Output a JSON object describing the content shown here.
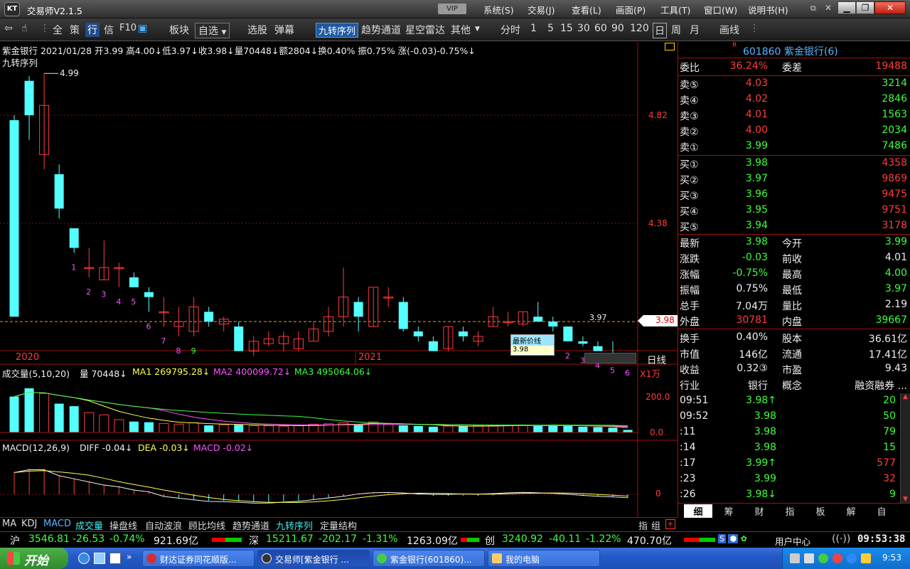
{
  "app": {
    "logo": "KT",
    "title": "交易师V2.1.5",
    "vip": "VIP"
  },
  "menu": [
    "系统(S)",
    "交易(J)",
    "查看(L)",
    "画面(P)",
    "工具(T)",
    "窗口(W)",
    "说明书(H)"
  ],
  "toolbar": {
    "all": "全",
    "policy": "策",
    "quote": "行",
    "info": "信",
    "f10": "F10",
    "sector": "板块",
    "watch": "自选",
    "select": "选股",
    "popup": "弹幕",
    "nine": "九转序列",
    "trend": "趋势通道",
    "radar": "星空雷达",
    "other": "其他",
    "periods": [
      "分时",
      "1",
      "5",
      "15",
      "30",
      "60",
      "90",
      "120",
      "日",
      "周",
      "月"
    ],
    "draw": "画线"
  },
  "kline": {
    "info": "紫金银行 2021/01/28 开3.99 高4.00↓低3.97↓收3.98↓量70448↓额2804↓换0.40% 振0.75% 涨(-0.03)-0.75%↓",
    "indicator": "九转序列",
    "peak": "4.99",
    "ticks": [
      "4.82",
      "4.38"
    ],
    "current_price": "3.98",
    "low_label": "3.97",
    "tooltip_title": "最新价线",
    "tooltip_value": "3.98",
    "years": [
      "2020",
      "2021"
    ],
    "period": "日线"
  },
  "volume": {
    "title": "成交量(5,10,20)",
    "v": "量 70448↓",
    "ma1": "MA1 269795.28↓",
    "ma2": "MA2 400099.72↓",
    "ma3": "MA3 495064.06↓",
    "unit": "X1万",
    "ticks": [
      "200.0",
      "0.0"
    ]
  },
  "macd": {
    "title": "MACD(12,26,9)",
    "diff": "DIFF -0.04↓",
    "dea": "DEA -0.03↓",
    "macd": "MACD -0.02↓",
    "tick": "0"
  },
  "bottom_tabs": [
    "MA",
    "KDJ",
    "MACD",
    "成交量",
    "操盘线",
    "自动波浪",
    "顾比均线",
    "趋势通道",
    "九转序列",
    "定量结构"
  ],
  "bottom_right": [
    "指",
    "组"
  ],
  "header": {
    "flag": "R",
    "code_name": "601860 紫金银行(6)"
  },
  "weibi": {
    "label": "委比",
    "value": "36.24%",
    "diff_label": "委差",
    "diff": "19488"
  },
  "sell": [
    {
      "l": "卖⑤",
      "p": "4.03",
      "v": "3214"
    },
    {
      "l": "卖④",
      "p": "4.02",
      "v": "2846"
    },
    {
      "l": "卖③",
      "p": "4.01",
      "v": "1563"
    },
    {
      "l": "卖②",
      "p": "4.00",
      "v": "2034"
    },
    {
      "l": "卖①",
      "p": "3.99",
      "v": "7486"
    }
  ],
  "buy": [
    {
      "l": "买①",
      "p": "3.98",
      "v": "4358"
    },
    {
      "l": "买②",
      "p": "3.97",
      "v": "9869"
    },
    {
      "l": "买③",
      "p": "3.96",
      "v": "9475"
    },
    {
      "l": "买④",
      "p": "3.95",
      "v": "9751"
    },
    {
      "l": "买⑤",
      "p": "3.94",
      "v": "3178"
    }
  ],
  "stats": [
    {
      "l1": "最新",
      "v1": "3.98",
      "c1": "grn",
      "l2": "今开",
      "v2": "3.99",
      "c2": "grn"
    },
    {
      "l1": "涨跌",
      "v1": "-0.03",
      "c1": "grn",
      "l2": "前收",
      "v2": "4.01",
      "c2": "wht"
    },
    {
      "l1": "涨幅",
      "v1": "-0.75%",
      "c1": "grn",
      "l2": "最高",
      "v2": "4.00",
      "c2": "grn"
    },
    {
      "l1": "振幅",
      "v1": "0.75%",
      "c1": "wht",
      "l2": "最低",
      "v2": "3.97",
      "c2": "grn"
    },
    {
      "l1": "总手",
      "v1": "7.04万",
      "c1": "wht",
      "l2": "量比",
      "v2": "2.19",
      "c2": "wht"
    },
    {
      "l1": "外盘",
      "v1": "30781",
      "c1": "red",
      "l2": "内盘",
      "v2": "39667",
      "c2": "grn"
    },
    {
      "l1": "换手",
      "v1": "0.40%",
      "c1": "wht",
      "l2": "股本",
      "v2": "36.61亿",
      "c2": "wht"
    },
    {
      "l1": "市值",
      "v1": "146亿",
      "c1": "wht",
      "l2": "流通",
      "v2": "17.41亿",
      "c2": "wht"
    },
    {
      "l1": "收益",
      "v1": "0.32③",
      "c1": "wht",
      "l2": "市盈",
      "v2": "9.43",
      "c2": "wht"
    },
    {
      "l1": "行业",
      "v1": "银行",
      "c1": "wht",
      "l2": "概念",
      "v2": "融资融券 ...",
      "c2": "wht"
    }
  ],
  "ticks": [
    {
      "t": "09:51",
      "p": "3.98↑",
      "pc": "grn",
      "v": "20",
      "vc": "grn"
    },
    {
      "t": "09:52",
      "p": "3.98",
      "pc": "grn",
      "v": "50",
      "vc": "grn"
    },
    {
      "t": ":11",
      "p": "3.98",
      "pc": "grn",
      "v": "79",
      "vc": "grn"
    },
    {
      "t": ":14",
      "p": "3.98",
      "pc": "grn",
      "v": "15",
      "vc": "grn"
    },
    {
      "t": ":17",
      "p": "3.99↑",
      "pc": "grn",
      "v": "577",
      "vc": "red"
    },
    {
      "t": ":23",
      "p": "3.99",
      "pc": "grn",
      "v": "32",
      "vc": "red"
    },
    {
      "t": ":26",
      "p": "3.98↓",
      "pc": "grn",
      "v": "9",
      "vc": "grn"
    }
  ],
  "right_tabs": [
    "细",
    "筹",
    "财",
    "指",
    "板",
    "解",
    "自"
  ],
  "index": {
    "sh": "沪",
    "sh_v": "3546.81",
    "sh_c": "-26.53",
    "sh_p": "-0.74%",
    "sh_a": "921.69亿",
    "sz": "深",
    "sz_v": "15211.67",
    "sz_c": "-202.17",
    "sz_p": "-1.31%",
    "sz_a": "1263.09亿",
    "cy": "创",
    "cy_v": "3240.92",
    "cy_c": "-40.11",
    "cy_p": "-1.22%",
    "cy_a": "470.70亿",
    "user": "用户中心",
    "time": "09:53:38"
  },
  "taskbar": {
    "start": "开始",
    "tasks": [
      "财达证券同花顺版...",
      "交易师[紫金银行 ...",
      "紫金银行(601860)...",
      "我的电脑"
    ],
    "clock": "9:53"
  },
  "chart_data": {
    "type": "candlestick",
    "candles": [
      {
        "o": 4.8,
        "h": 4.82,
        "l": 4.0,
        "c": 4.0
      },
      {
        "o": 4.96,
        "h": 4.98,
        "l": 4.72,
        "c": 4.82
      },
      {
        "o": 4.66,
        "h": 4.99,
        "l": 4.6,
        "c": 4.86
      },
      {
        "o": 4.58,
        "h": 4.62,
        "l": 4.4,
        "c": 4.44
      },
      {
        "o": 4.36,
        "h": 4.36,
        "l": 4.26,
        "c": 4.28
      },
      {
        "o": 4.2,
        "h": 4.28,
        "l": 4.16,
        "c": 4.2
      },
      {
        "o": 4.15,
        "h": 4.31,
        "l": 4.15,
        "c": 4.2
      },
      {
        "o": 4.2,
        "h": 4.22,
        "l": 4.12,
        "c": 4.2
      },
      {
        "o": 4.16,
        "h": 4.18,
        "l": 4.12,
        "c": 4.12
      },
      {
        "o": 4.1,
        "h": 4.12,
        "l": 4.02,
        "c": 4.08
      },
      {
        "o": 4.02,
        "h": 4.08,
        "l": 3.96,
        "c": 4.02
      },
      {
        "o": 3.96,
        "h": 4.04,
        "l": 3.92,
        "c": 3.98
      },
      {
        "o": 3.94,
        "h": 4.08,
        "l": 3.92,
        "c": 4.04
      },
      {
        "o": 4.02,
        "h": 4.04,
        "l": 3.96,
        "c": 3.98
      },
      {
        "o": 3.97,
        "h": 4.0,
        "l": 3.94,
        "c": 3.99
      },
      {
        "o": 3.96,
        "h": 3.98,
        "l": 3.86,
        "c": 3.86
      },
      {
        "o": 3.86,
        "h": 3.92,
        "l": 3.84,
        "c": 3.9
      },
      {
        "o": 3.89,
        "h": 3.94,
        "l": 3.88,
        "c": 3.91
      },
      {
        "o": 3.89,
        "h": 3.94,
        "l": 3.86,
        "c": 3.92
      },
      {
        "o": 3.87,
        "h": 3.94,
        "l": 3.86,
        "c": 3.91
      },
      {
        "o": 3.9,
        "h": 3.98,
        "l": 3.9,
        "c": 3.95
      },
      {
        "o": 3.94,
        "h": 4.04,
        "l": 3.92,
        "c": 4.0
      },
      {
        "o": 4.0,
        "h": 4.2,
        "l": 3.96,
        "c": 4.08
      },
      {
        "o": 4.06,
        "h": 4.08,
        "l": 3.94,
        "c": 4.0
      },
      {
        "o": 3.96,
        "h": 4.12,
        "l": 3.96,
        "c": 4.12
      },
      {
        "o": 4.08,
        "h": 4.12,
        "l": 4.04,
        "c": 4.08
      },
      {
        "o": 4.06,
        "h": 4.08,
        "l": 3.94,
        "c": 3.95
      },
      {
        "o": 3.94,
        "h": 3.96,
        "l": 3.9,
        "c": 3.92
      },
      {
        "o": 3.9,
        "h": 3.92,
        "l": 3.86,
        "c": 3.86
      },
      {
        "o": 3.87,
        "h": 3.96,
        "l": 3.86,
        "c": 3.96
      },
      {
        "o": 3.94,
        "h": 3.96,
        "l": 3.9,
        "c": 3.92
      },
      {
        "o": 3.9,
        "h": 3.94,
        "l": 3.88,
        "c": 3.92
      },
      {
        "o": 3.96,
        "h": 4.04,
        "l": 3.96,
        "c": 4.0
      },
      {
        "o": 3.98,
        "h": 4.02,
        "l": 3.96,
        "c": 3.98
      },
      {
        "o": 3.97,
        "h": 4.02,
        "l": 3.96,
        "c": 4.02
      },
      {
        "o": 4.0,
        "h": 4.06,
        "l": 3.98,
        "c": 3.98
      },
      {
        "o": 3.98,
        "h": 4.0,
        "l": 3.94,
        "c": 3.96
      },
      {
        "o": 3.96,
        "h": 3.96,
        "l": 3.9,
        "c": 3.9
      },
      {
        "o": 3.9,
        "h": 3.92,
        "l": 3.88,
        "c": 3.89
      },
      {
        "o": 3.88,
        "h": 3.9,
        "l": 3.86,
        "c": 3.86
      },
      {
        "o": 3.85,
        "h": 3.9,
        "l": 3.84,
        "c": 3.84
      },
      {
        "o": 3.84,
        "h": 3.84,
        "l": 3.83,
        "c": 3.83
      }
    ],
    "nine_seq": [
      {
        "i": 4,
        "n": "1"
      },
      {
        "i": 5,
        "n": "2"
      },
      {
        "i": 6,
        "n": "3"
      },
      {
        "i": 7,
        "n": "4"
      },
      {
        "i": 8,
        "n": "5"
      },
      {
        "i": 9,
        "n": "6"
      },
      {
        "i": 10,
        "n": "7"
      },
      {
        "i": 11,
        "n": "8"
      },
      {
        "i": 12,
        "n": "9"
      },
      {
        "i": 36,
        "n": "1"
      },
      {
        "i": 37,
        "n": "2"
      },
      {
        "i": 38,
        "n": "3"
      },
      {
        "i": 39,
        "n": "4"
      },
      {
        "i": 40,
        "n": "5"
      },
      {
        "i": 41,
        "n": "6"
      }
    ],
    "volume": [
      112,
      138,
      122,
      90,
      82,
      62,
      55,
      40,
      34,
      32,
      28,
      26,
      30,
      22,
      24,
      24,
      21,
      21,
      20,
      21,
      26,
      27,
      30,
      24,
      33,
      26,
      22,
      20,
      18,
      20,
      19,
      21,
      22,
      22,
      23,
      21,
      24,
      20,
      18,
      17,
      15,
      8
    ],
    "macd_bars": [
      0.7,
      0.8,
      0.8,
      0.6,
      0.5,
      0.4,
      0.3,
      0.25,
      0.15,
      0.1,
      -0.05,
      -0.1,
      -0.15,
      -0.2,
      -0.2,
      -0.22,
      -0.25,
      -0.25,
      -0.22,
      -0.2,
      -0.15,
      -0.1,
      -0.05,
      0.02,
      0.05,
      0.05,
      0.02,
      -0.02,
      -0.05,
      -0.05,
      -0.04,
      -0.05,
      -0.03,
      0,
      0.02,
      0.01,
      0,
      -0.02,
      -0.05,
      -0.07,
      -0.08,
      -0.1
    ]
  }
}
